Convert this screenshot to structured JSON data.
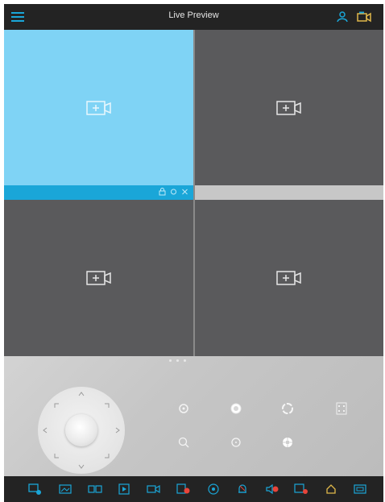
{
  "header": {
    "title": "Live Preview"
  },
  "colors": {
    "accent": "#1aa6d8",
    "selected_tile": "#7fd3f5",
    "tile": "#5a5a5c",
    "bar": "#232323",
    "record_dot": "#e8443a"
  },
  "tiles": [
    {
      "icon": "add-camera-icon",
      "selected": true
    },
    {
      "icon": "add-camera-icon",
      "selected": false
    },
    {
      "icon": "add-camera-icon",
      "selected": false
    },
    {
      "icon": "add-camera-icon",
      "selected": false
    }
  ],
  "ptz_controls": [
    "iris-icon",
    "focus-icon",
    "zoom-icon",
    "preset-icon",
    "zoom-out-icon",
    "focus-out-icon",
    "iris-out-icon"
  ],
  "toolbar_icons": [
    "ptz-icon",
    "picture-icon",
    "dual-screen-icon",
    "playback-icon",
    "video-icon",
    "record-icon",
    "settings-icon",
    "alarm-icon",
    "audio-icon",
    "capture-icon",
    "home-icon",
    "fullscreen-icon"
  ]
}
